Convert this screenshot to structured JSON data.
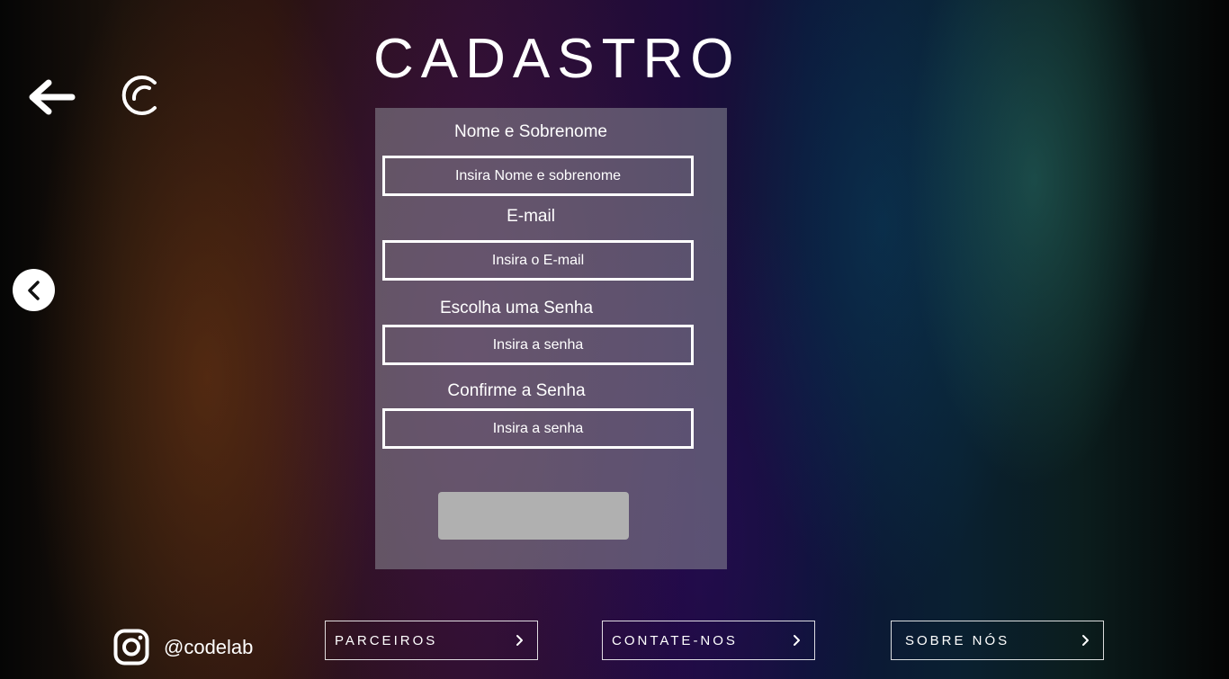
{
  "header": {
    "title": "CADASTRO",
    "back_icon": "arrow-left-icon",
    "logo_icon": "codelab-c-logo"
  },
  "nav": {
    "prev_icon": "chevron-left-icon"
  },
  "form": {
    "fields": [
      {
        "label": "Nome e Sobrenome",
        "placeholder": "Insira Nome e sobrenome",
        "value": ""
      },
      {
        "label": "E-mail",
        "placeholder": "Insira o E-mail",
        "value": ""
      },
      {
        "label": "Escolha uma Senha",
        "placeholder": "Insira a senha",
        "value": ""
      },
      {
        "label": "Confirme a Senha",
        "placeholder": "Insira a senha",
        "value": ""
      }
    ],
    "submit_label": ""
  },
  "footer": {
    "instagram_icon": "instagram-icon",
    "handle": "@codelab",
    "links": [
      {
        "label": "PARCEIROS",
        "icon": "chevron-right-icon"
      },
      {
        "label": "CONTATE-NOS",
        "icon": "chevron-right-icon"
      },
      {
        "label": "SOBRE NÓS",
        "icon": "chevron-right-icon"
      }
    ]
  },
  "colors": {
    "panel": "#8c8c96",
    "submit_button": "#b0b0b0",
    "text": "#ffffff"
  }
}
